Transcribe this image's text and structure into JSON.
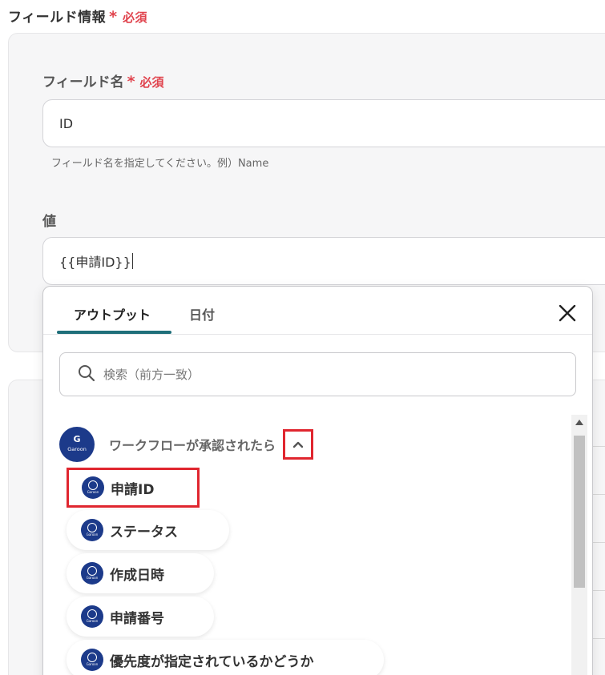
{
  "section": {
    "title": "フィールド情報",
    "req_star": "*",
    "req_text": "必須"
  },
  "field_name": {
    "label": "フィールド名",
    "req_star": "*",
    "req_text": "必須",
    "value": "ID",
    "hint": "フィールド名を指定してください。例）Name"
  },
  "value_field": {
    "label": "値",
    "value": "{{申請ID}}"
  },
  "popup": {
    "tabs": [
      {
        "label": "アウトプット"
      },
      {
        "label": "日付"
      }
    ],
    "search_placeholder": "検索（前方一致）",
    "group": {
      "icon_letter": "G",
      "icon_text": "Garoon",
      "label": "ワークフローが承認されたら"
    },
    "items": [
      {
        "label": "申請ID"
      },
      {
        "label": "ステータス"
      },
      {
        "label": "作成日時"
      },
      {
        "label": "申請番号"
      },
      {
        "label": "優先度が指定されているかどうか"
      }
    ],
    "item_icon_text": "Garoon"
  },
  "colors": {
    "accent": "#1f6f7a",
    "required": "#e0434d",
    "highlight": "#e0262f",
    "garoon": "#1c3a8a"
  }
}
